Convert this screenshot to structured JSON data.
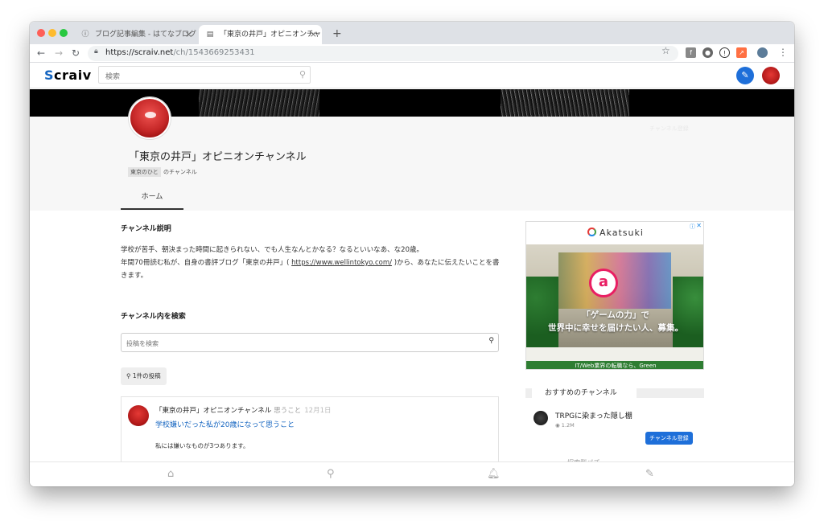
{
  "browser": {
    "tabs": [
      {
        "label": "ブログ記事編集 - はてなブログ",
        "active": false
      },
      {
        "label": "「東京の井戸」オピニオンチャンネル",
        "active": true
      }
    ],
    "new_tab": "+",
    "tab_close": "×",
    "url_host": "https://scraiv.net",
    "url_path": "/ch/1543669253431"
  },
  "site": {
    "logo_first": "S",
    "logo_rest": "craiv",
    "search_placeholder": "検索"
  },
  "channel": {
    "title": "「東京の井戸」オピニオンチャンネル",
    "owner": "東京のひと",
    "owner_suffix": "のチャンネル",
    "subscribe_ghost": "チャンネル登録",
    "tabs": [
      "ホーム"
    ]
  },
  "main": {
    "description_heading": "チャンネル説明",
    "description_line1": "学校が苦手、朝決まった時間に起きられない、でも人生なんとかなる？なるといいなあ、な20歳。",
    "description_line2_pre": "年間70冊読む私が、自身の書評ブログ「東京の井戸」( ",
    "description_link": "https://www.wellintokyo.com/",
    "description_line2_post": " )から、あなたに伝えたいことを書きます。",
    "search_heading": "チャンネル内を検索",
    "search_placeholder": "投稿を検索",
    "post_count": "1件の投稿"
  },
  "post": {
    "channel": "「東京の井戸」オピニオンチャンネル",
    "category": "思うこと",
    "date": "12月1日",
    "title": "学校嫌いだった私が20歳になって思うこと",
    "excerpt": "私には嫌いなものが3つあります。"
  },
  "ad": {
    "brand": "Akatsuki",
    "copy_line1": "「ゲームの力」で",
    "copy_line2": "世界中に幸せを届けたい人、募集。",
    "footer": "IT/Web業界の転職なら、Green"
  },
  "sidebar": {
    "recommended_heading": "おすすめのチャンネル",
    "rec_channel_name": "TRPGに染まった隠し棚",
    "rec_views": "1.2M",
    "rec_subscribe": "チャンネル登録",
    "rec_next": "― ― ― ― 探索型パズ ― ― ― ― ―"
  }
}
